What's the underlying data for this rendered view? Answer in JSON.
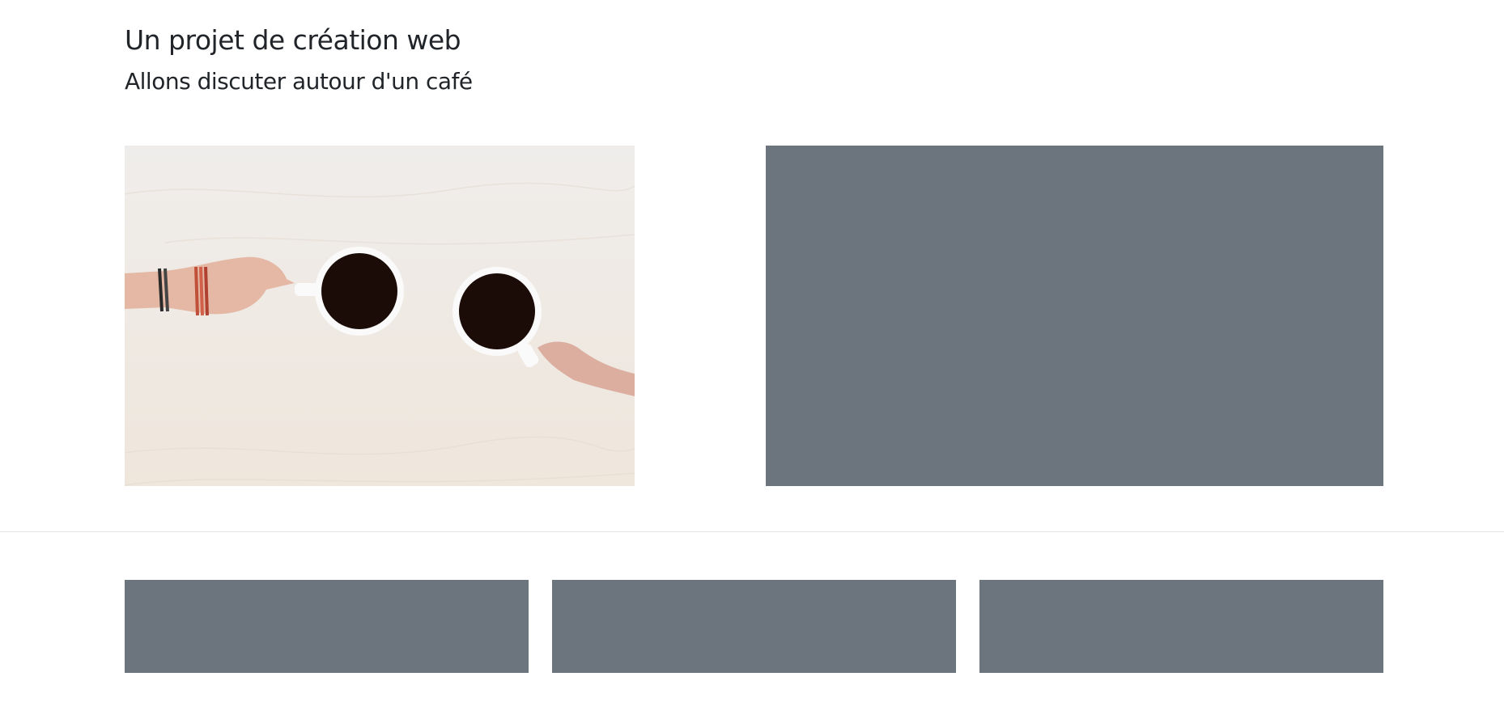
{
  "header": {
    "title": "Un projet de création web",
    "subtitle": "Allons discuter autour d'un café"
  },
  "colors": {
    "placeholder": "#6c757d",
    "divider": "#e5e5e5"
  },
  "images": {
    "hero_photo": "coffee-cups-photo"
  }
}
